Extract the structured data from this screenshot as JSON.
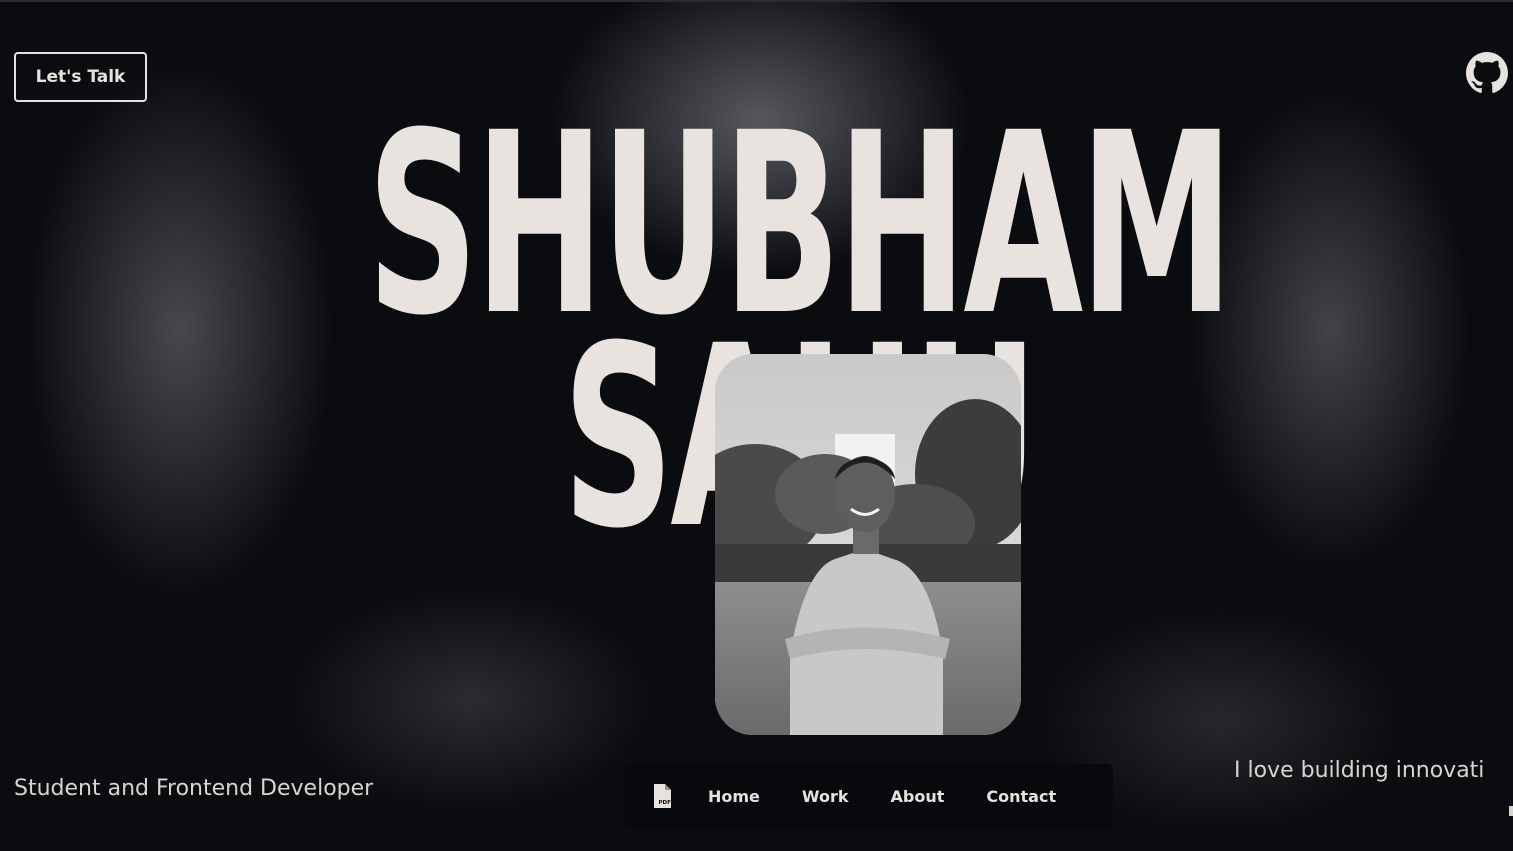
{
  "header": {
    "cta_label": "Let's Talk",
    "github_icon": "github-icon"
  },
  "hero": {
    "name_line_1": "SHUBHAM",
    "name_line_2": "SAHU",
    "photo_alt": "Portrait photo",
    "tagline": "Student and Frontend Developer",
    "intro_marquee": "I love building innovati"
  },
  "nav": {
    "resume_icon": "pdf-file-icon",
    "items": [
      {
        "label": "Home"
      },
      {
        "label": "Work"
      },
      {
        "label": "About"
      },
      {
        "label": "Contact"
      }
    ]
  },
  "colors": {
    "background": "#0b0c10",
    "text_light": "#e8e3de",
    "nav_bg": "#08090c"
  }
}
